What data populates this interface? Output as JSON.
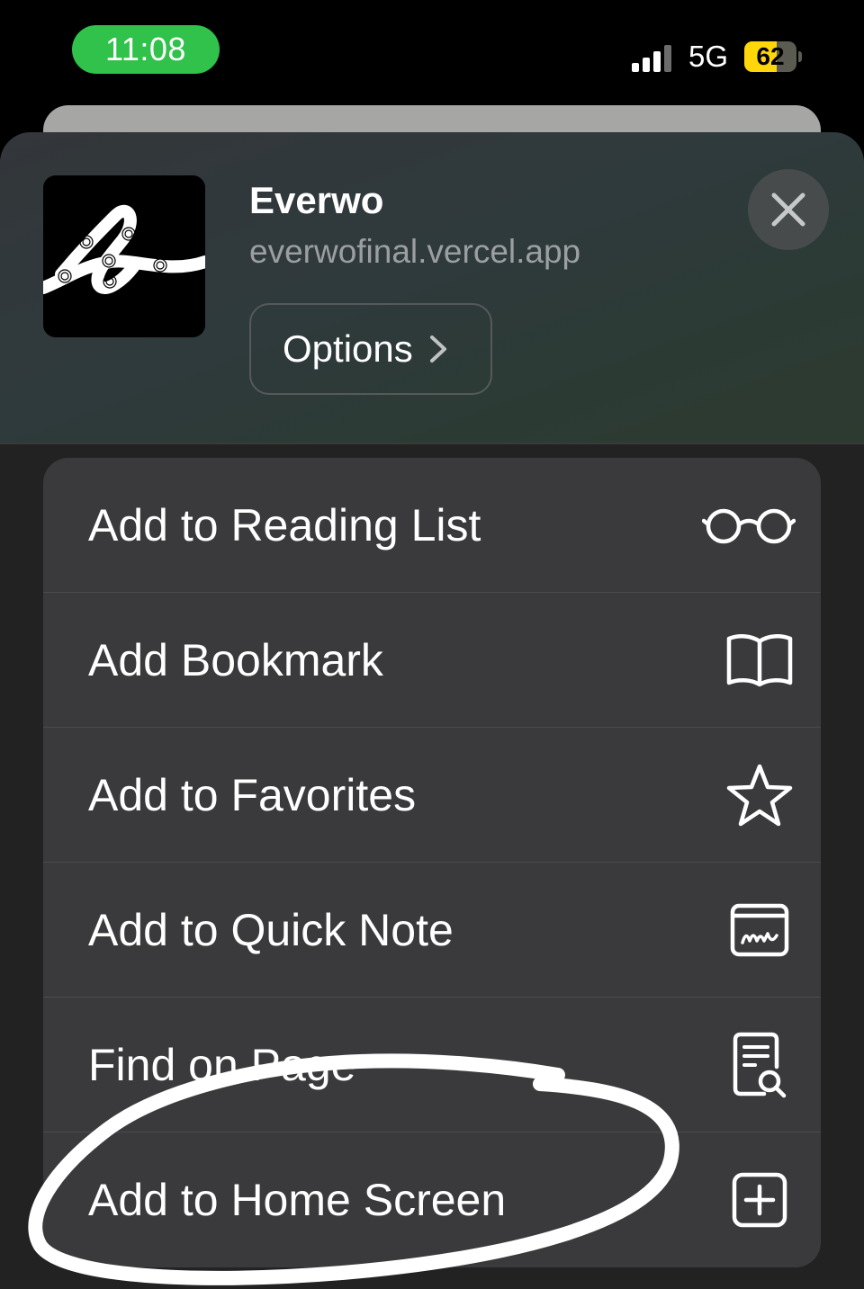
{
  "status_bar": {
    "time": "11:08",
    "network": "5G",
    "battery": "62",
    "battery_level": 0.62
  },
  "share_sheet": {
    "app": {
      "title": "Everwo",
      "url": "everwofinal.vercel.app"
    },
    "options_label": "Options",
    "actions": [
      {
        "label": "Add to Reading List",
        "icon": "glasses-icon"
      },
      {
        "label": "Add Bookmark",
        "icon": "book-icon"
      },
      {
        "label": "Add to Favorites",
        "icon": "star-icon"
      },
      {
        "label": "Add to Quick Note",
        "icon": "quick-note-icon"
      },
      {
        "label": "Find on Page",
        "icon": "find-on-page-icon"
      },
      {
        "label": "Add to Home Screen",
        "icon": "add-square-icon"
      }
    ]
  },
  "colors": {
    "time_pill": "#30c24a",
    "battery_fill": "#ffd60a",
    "row_background": "#3a3a3c",
    "annotation": "#ffffff"
  }
}
